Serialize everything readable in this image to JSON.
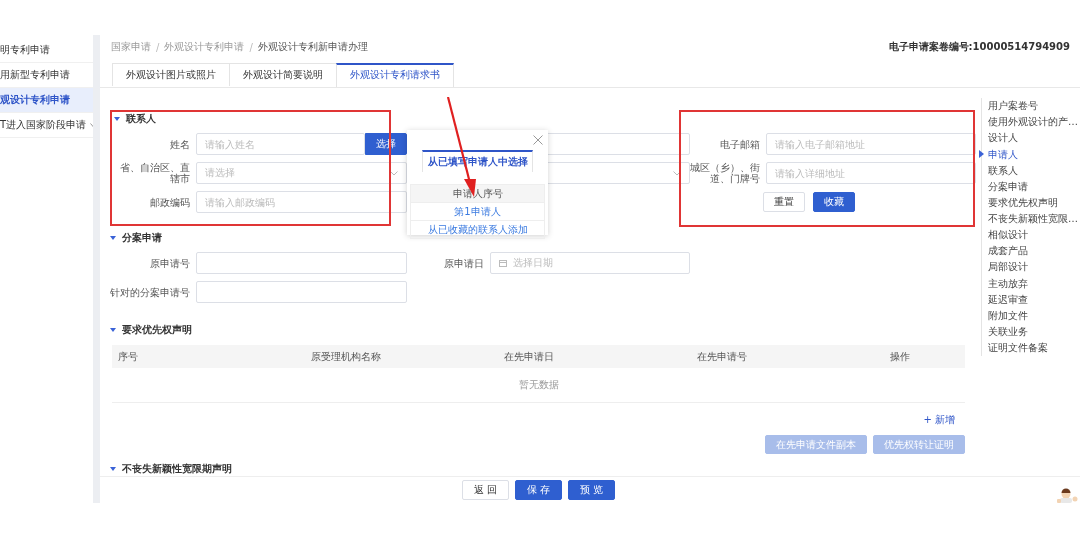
{
  "sidebar": {
    "items": [
      {
        "label": "明专利申请",
        "selected": false,
        "expandable": false
      },
      {
        "label": "用新型专利申请",
        "selected": false,
        "expandable": false
      },
      {
        "label": "观设计专利申请",
        "selected": true,
        "expandable": false
      },
      {
        "label": "T进入国家阶段申请",
        "selected": false,
        "expandable": true
      }
    ]
  },
  "breadcrumb": {
    "separator": "/",
    "items": [
      "国家申请",
      "外观设计专利申请",
      "外观设计专利新申请办理"
    ]
  },
  "case_number": "电子申请案卷编号:10000514794909",
  "tabs": [
    {
      "label": "外观设计图片或照片",
      "selected": false
    },
    {
      "label": "外观设计简要说明",
      "selected": false
    },
    {
      "label": "外观设计专利请求书",
      "selected": true
    }
  ],
  "contact": {
    "title": "联系人",
    "rows": [
      [
        {
          "kind": "lookup",
          "label": "姓名",
          "placeholder": "请输入姓名",
          "button": "选择"
        },
        {
          "kind": "input"
        },
        {
          "kind": "input",
          "label": "电子邮箱",
          "placeholder": "请输入电子邮箱地址"
        }
      ],
      [
        {
          "kind": "select",
          "label": "省、自治区、直辖市",
          "placeholder": "请选择"
        },
        {
          "kind": "select"
        },
        {
          "kind": "input",
          "label": "城区（乡）、街道、门牌号",
          "placeholder": "请输入详细地址"
        }
      ],
      [
        {
          "kind": "input",
          "label": "邮政编码",
          "placeholder": "请输入邮政编码"
        },
        {
          "kind": "blank"
        },
        {
          "kind": "actions",
          "buttons": [
            {
              "label": "重置",
              "primary": false
            },
            {
              "label": "收藏",
              "primary": true
            }
          ]
        }
      ]
    ]
  },
  "division": {
    "title": "分案申请",
    "rows": [
      [
        {
          "kind": "input",
          "label": "原申请号"
        },
        {
          "kind": "date",
          "label": "原申请日",
          "placeholder": "选择日期"
        }
      ],
      [
        {
          "kind": "input",
          "label": "针对的分案申请号"
        }
      ]
    ]
  },
  "priority": {
    "title": "要求优先权声明",
    "columns": [
      "序号",
      "原受理机构名称",
      "在先申请日",
      "在先申请号",
      "操作"
    ],
    "empty_text": "暂无数据",
    "add_link": "+ 新增",
    "buttons": [
      {
        "label": "在先申请文件副本",
        "disabled": true
      },
      {
        "label": "优先权转让证明",
        "disabled": true
      }
    ]
  },
  "grace": {
    "title": "不丧失新颖性宽限期声明"
  },
  "footer_buttons": [
    {
      "label": "返回",
      "primary": false
    },
    {
      "label": "保存",
      "primary": true
    },
    {
      "label": "预览",
      "primary": true
    }
  ],
  "anchor_nav": {
    "items": [
      {
        "label": "用户案卷号",
        "selected": false
      },
      {
        "label": "使用外观设计的产…",
        "selected": false
      },
      {
        "label": "设计人",
        "selected": false
      },
      {
        "label": "申请人",
        "selected": true
      },
      {
        "label": "联系人",
        "selected": false
      },
      {
        "label": "分案申请",
        "selected": false
      },
      {
        "label": "要求优先权声明",
        "selected": false
      },
      {
        "label": "不丧失新颖性宽限…",
        "selected": false
      },
      {
        "label": "相似设计",
        "selected": false
      },
      {
        "label": "成套产品",
        "selected": false
      },
      {
        "label": "局部设计",
        "selected": false
      },
      {
        "label": "主动放弃",
        "selected": false
      },
      {
        "label": "延迟审查",
        "selected": false
      },
      {
        "label": "附加文件",
        "selected": false
      },
      {
        "label": "关联业务",
        "selected": false
      },
      {
        "label": "证明文件备案",
        "selected": false
      }
    ]
  },
  "popup": {
    "tab": "从已填写申请人中选择",
    "header": "申请人序号",
    "rows": [
      "第1申请人",
      "从已收藏的联系人添加"
    ]
  }
}
